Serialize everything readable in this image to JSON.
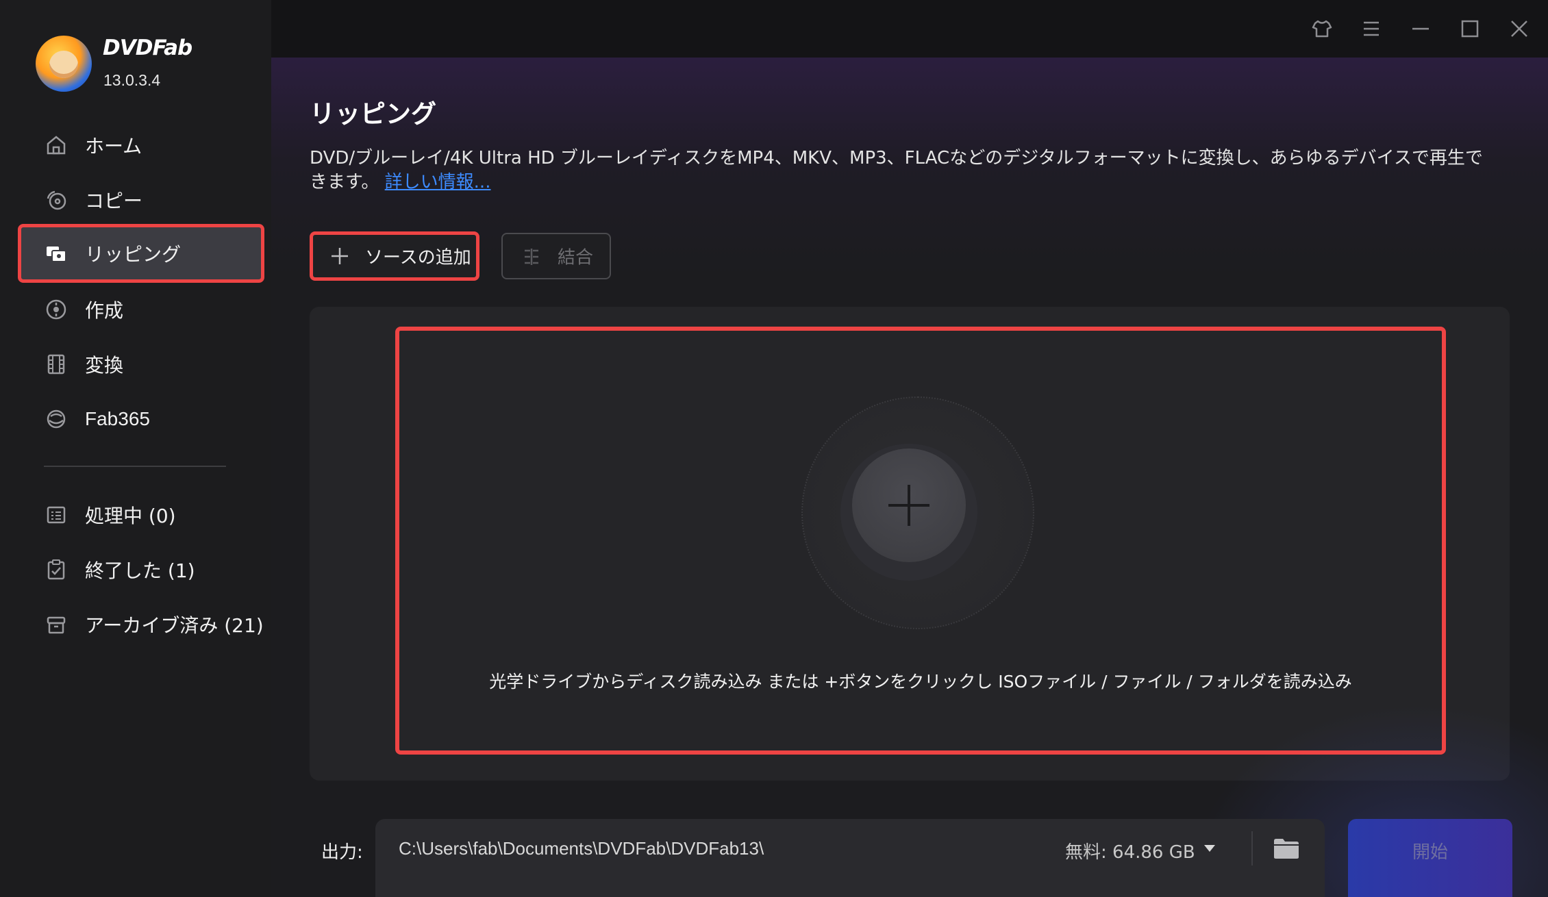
{
  "app": {
    "brand": "DVDFab",
    "version": "13.0.3.4"
  },
  "sidebar": {
    "items": [
      {
        "label": "ホーム",
        "icon": "home-icon"
      },
      {
        "label": "コピー",
        "icon": "copy-disc-icon"
      },
      {
        "label": "リッピング",
        "icon": "ripper-icon",
        "active": true
      },
      {
        "label": "作成",
        "icon": "creator-icon"
      },
      {
        "label": "変換",
        "icon": "film-icon"
      },
      {
        "label": "Fab365",
        "icon": "fab365-icon"
      }
    ],
    "queue": [
      {
        "label": "処理中 (0)",
        "icon": "task-list-icon"
      },
      {
        "label": "終了した (1)",
        "icon": "finished-clipboard-icon"
      },
      {
        "label": "アーカイブ済み (21)",
        "icon": "archive-box-icon"
      }
    ]
  },
  "titlebar": {
    "buttons": [
      "theme-shirt-icon",
      "menu-icon",
      "minimize-icon",
      "maximize-icon",
      "close-icon"
    ]
  },
  "main": {
    "title": "リッピング",
    "description": "DVD/ブルーレイ/4K Ultra HD ブルーレイディスクをMP4、MKV、MP3、FLACなどのデジタルフォーマットに変換し、あらゆるデバイスで再生できます。",
    "more_link": "詳しい情報...",
    "add_source": "ソースの追加",
    "merge": "結合",
    "drop_hint": "光学ドライブからディスク読み込み または +ボタンをクリックし ISOファイル / ファイル / フォルダを読み込み"
  },
  "output": {
    "label": "出力:",
    "path": "C:\\Users\\fab\\Documents\\DVDFab\\DVDFab13\\",
    "free": "無料: 64.86 GB",
    "start": "開始"
  },
  "colors": {
    "highlight": "#ee4444",
    "link": "#3d8bff",
    "start_button": "#2a3aa8"
  }
}
